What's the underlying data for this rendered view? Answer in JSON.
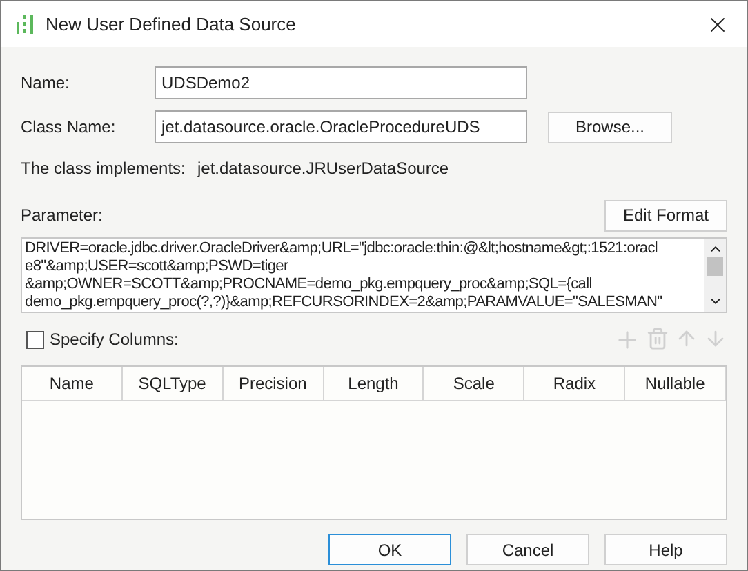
{
  "window": {
    "title": "New User Defined Data Source"
  },
  "name_field": {
    "label": "Name:",
    "value": "UDSDemo2"
  },
  "class_field": {
    "label": "Class Name:",
    "value": "jet.datasource.oracle.OracleProcedureUDS"
  },
  "browse_button": "Browse...",
  "implements": {
    "label": "The class implements:",
    "value": "jet.datasource.JRUserDataSource"
  },
  "parameter": {
    "label": "Parameter:",
    "button": "Edit Format",
    "lines": [
      "DRIVER=oracle.jdbc.driver.OracleDriver&amp;URL=\"jdbc:oracle:thin:@&lt;hostname&gt;:1521:oracl",
      "e8\"&amp;USER=scott&amp;PSWD=tiger",
      "&amp;OWNER=SCOTT&amp;PROCNAME=demo_pkg.empquery_proc&amp;SQL={call",
      "demo_pkg.empquery_proc(?,?)}&amp;REFCURSORINDEX=2&amp;PARAMVALUE=\"SALESMAN\""
    ]
  },
  "specify_columns": {
    "label": "Specify Columns:",
    "checked": false
  },
  "table": {
    "columns": [
      "Name",
      "SQLType",
      "Precision",
      "Length",
      "Scale",
      "Radix",
      "Nullable"
    ]
  },
  "buttons": [
    {
      "label": "OK",
      "default": true
    },
    {
      "label": "Cancel",
      "default": false
    },
    {
      "label": "Help",
      "default": false
    }
  ]
}
